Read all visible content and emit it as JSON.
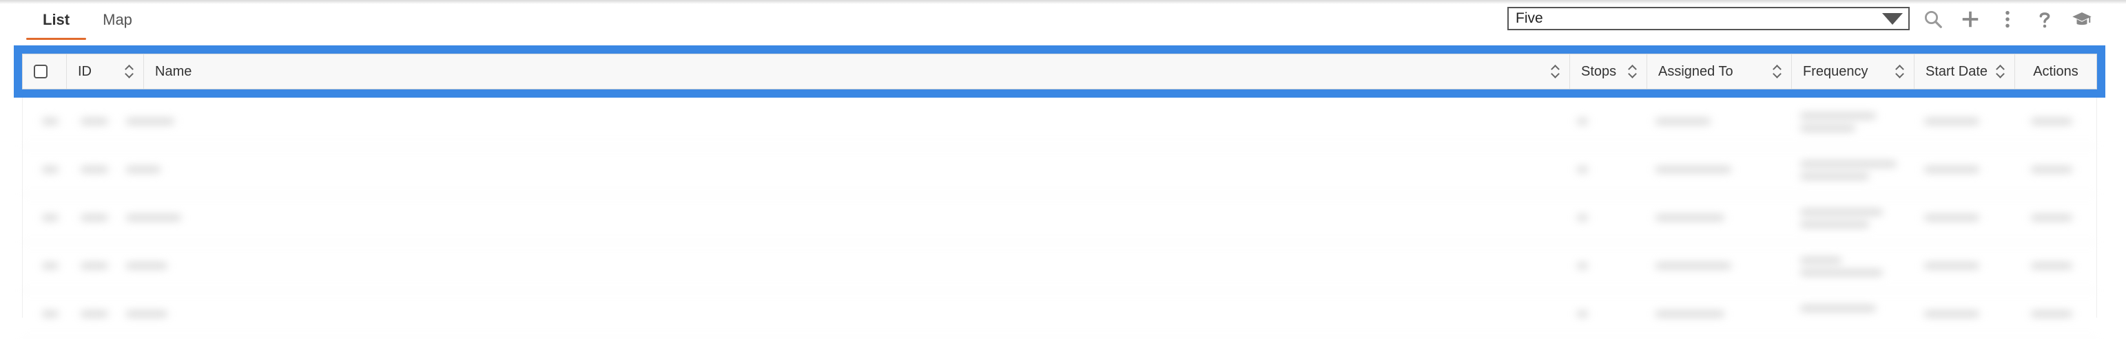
{
  "tabs": [
    {
      "label": "List",
      "active": true
    },
    {
      "label": "Map",
      "active": false
    }
  ],
  "toolbar": {
    "select_value": "Five",
    "icons": [
      "search-icon",
      "plus-icon",
      "more-vertical-icon",
      "help-icon",
      "graduation-cap-icon"
    ]
  },
  "table": {
    "columns": [
      "ID",
      "Name",
      "Stops",
      "Assigned To",
      "Frequency",
      "Start Date",
      "Actions"
    ],
    "blurred_row_count": 5
  },
  "colors": {
    "highlight": "#3a87e3",
    "tab_accent": "#e06a2c"
  }
}
